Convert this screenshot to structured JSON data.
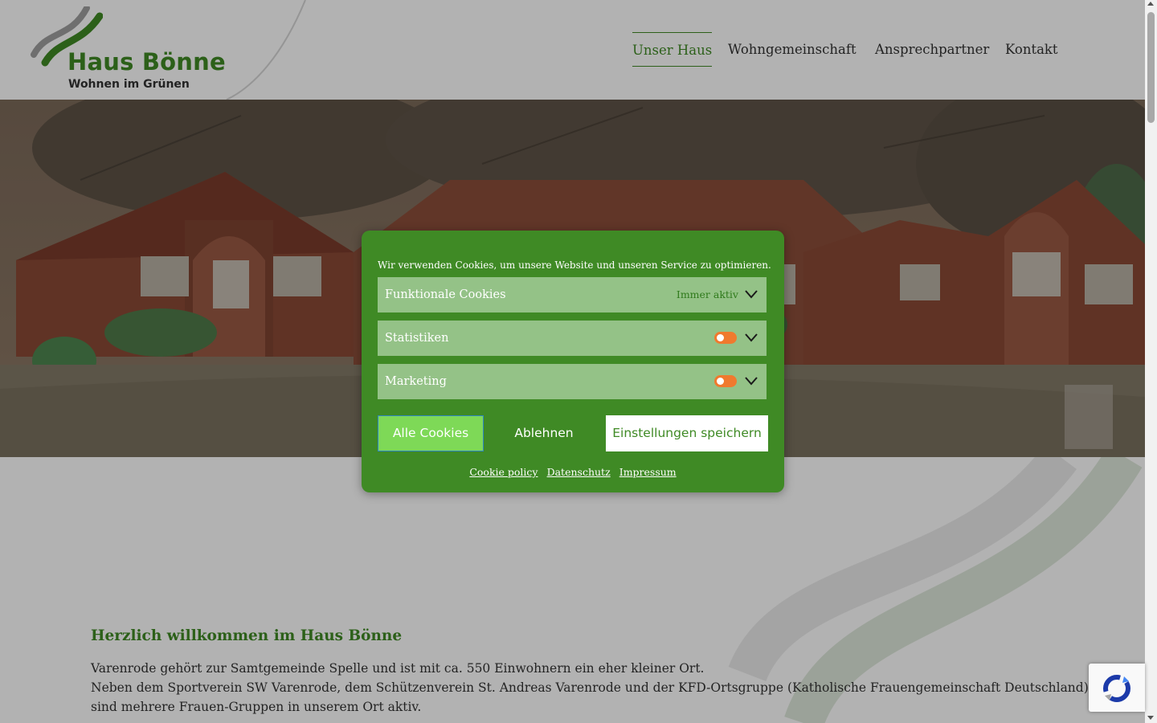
{
  "brand": {
    "title": "Haus Bönne",
    "subtitle": "Wohnen im Grünen",
    "color_primary": "#3f8a25",
    "color_gray": "#a0a0a0"
  },
  "nav": {
    "items": [
      {
        "label": "Unser Haus",
        "active": true
      },
      {
        "label": "Wohngemeinschaft",
        "active": false
      },
      {
        "label": "Ansprechpartner",
        "active": false
      },
      {
        "label": "Kontakt",
        "active": false
      }
    ]
  },
  "hero": {
    "image": "Hand-drawn sketch of a red brick house with trees"
  },
  "cookie_banner": {
    "message": "Wir verwenden Cookies, um unsere Website und unseren Service zu optimieren.",
    "categories": [
      {
        "label": "Funktionale Cookies",
        "status": "Immer aktiv",
        "toggle": null
      },
      {
        "label": "Statistiken",
        "status": null,
        "toggle": "off"
      },
      {
        "label": "Marketing",
        "status": null,
        "toggle": "off"
      }
    ],
    "buttons": {
      "accept_all": "Alle Cookies",
      "deny": "Ablehnen",
      "save": "Einstellungen speichern"
    },
    "links": {
      "policy": "Cookie policy",
      "privacy": "Datenschutz",
      "imprint": "Impressum"
    },
    "colors": {
      "background": "#3f8a25",
      "category": "#94c287",
      "toggle_off": "#f07a2e",
      "accept": "#7ed957"
    }
  },
  "content": {
    "welcome_title": "Herzlich willkommen im Haus Bönne",
    "paragraph_lines": [
      "Varenrode gehört zur Samtgemeinde Spelle und ist mit ca. 550 Einwohnern ein eher kleiner Ort.",
      "Neben dem Sportverein SW Varenrode, dem Schützenverein St. Andreas Varenrode und der KFD-Ortsgruppe (Katholische Frauengemeinschaft Deutschland)",
      "sind mehrere Frauen-Gruppen in unserem Ort aktiv."
    ]
  },
  "icons": {
    "logo_mark": "wave-logo-icon",
    "expand": "chevron-down-icon",
    "recaptcha": "recaptcha-icon"
  }
}
